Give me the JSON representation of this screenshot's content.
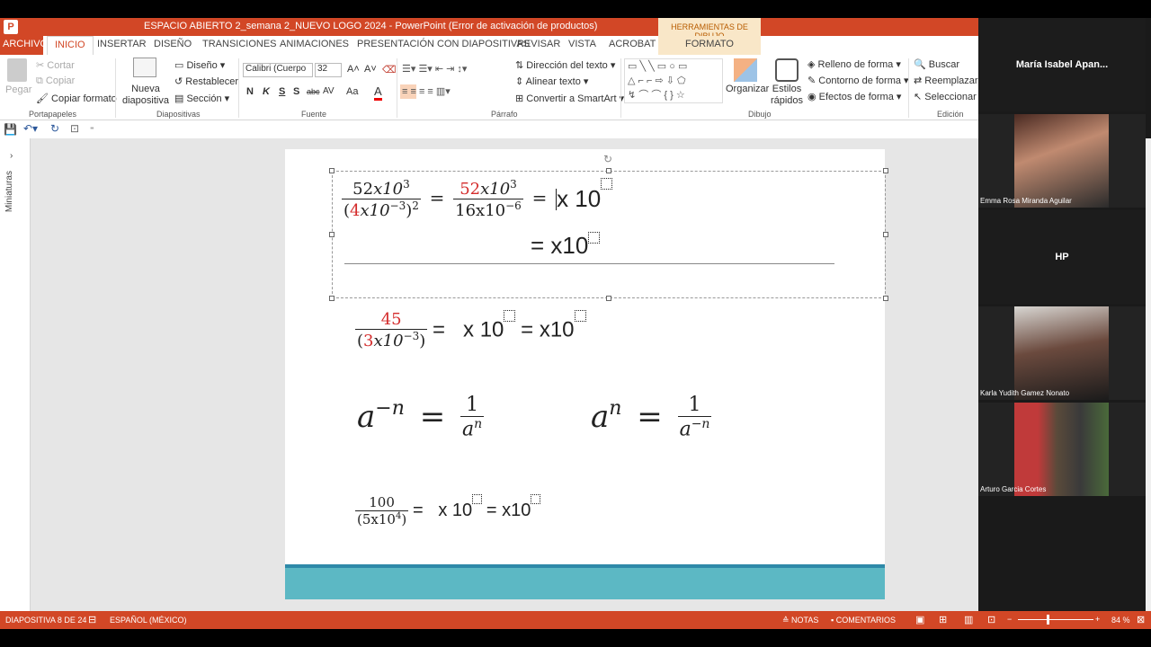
{
  "window": {
    "title": "ESPACIO ABIERTO 2_semana 2_NUEVO LOGO 2024 - PowerPoint (Error de activación de productos)",
    "app_icon": "P"
  },
  "context_tab": {
    "group": "HERRAMIENTAS DE DIBUJO",
    "tab": "FORMATO"
  },
  "tabs": [
    "ARCHIVO",
    "INICIO",
    "INSERTAR",
    "DISEÑO",
    "TRANSICIONES",
    "ANIMACIONES",
    "PRESENTACIÓN CON DIAPOSITIVAS",
    "REVISAR",
    "VISTA",
    "ACROBAT"
  ],
  "ribbon": {
    "portapapeles": {
      "paste": "Pegar",
      "cut": "Cortar",
      "copy": "Copiar",
      "format_painter": "Copiar formato",
      "label": "Portapapeles"
    },
    "diapositivas": {
      "new_slide": "Nueva diapositiva",
      "layout": "Diseño",
      "reset": "Restablecer",
      "section": "Sección",
      "label": "Diapositivas"
    },
    "fuente": {
      "font": "Calibri (Cuerpo",
      "size": "32",
      "label": "Fuente",
      "bold": "N",
      "italic": "K",
      "underline": "S",
      "shadow": "S",
      "strike": "abc",
      "spacing": "AV",
      "case": "Aa",
      "color": "A"
    },
    "parrafo": {
      "direction": "Dirección del texto",
      "align": "Alinear texto",
      "smartart": "Convertir a SmartArt",
      "label": "Párrafo"
    },
    "dibujo": {
      "arrange": "Organizar",
      "quick_styles": "Estilos rápidos",
      "fill": "Relleno de forma",
      "outline": "Contorno de forma",
      "effects": "Efectos de forma",
      "label": "Dibujo"
    },
    "edicion": {
      "find": "Buscar",
      "replace": "Reemplazar",
      "select": "Seleccionar",
      "label": "Edición"
    }
  },
  "sidebar": {
    "label": "Miniaturas"
  },
  "slide": {
    "eq1": {
      "n1": "52",
      "n1b": "x10",
      "n1e": "3",
      "d1a": "(",
      "d1r": "4",
      "d1b": "x10",
      "d1e": "−3",
      "d1c": ")",
      "d1p": "2",
      "eq": "=",
      "n2r": "52",
      "n2b": "x10",
      "n2e": "3",
      "d2": "16x10",
      "d2e": "−6",
      "rhs": "x 10"
    },
    "eq1b": {
      "text": "= x10"
    },
    "eq2": {
      "num": "45",
      "d1": "(",
      "dr": "3",
      "d2": "x10",
      "de": "−3",
      "d3": ")",
      "rhs1": "=   x 10",
      "rhs2": "= x10"
    },
    "eq3": {
      "lhs": "a",
      "exp": "−n",
      "eq": "=",
      "num": "1",
      "den": "a",
      "dexp": "n"
    },
    "eq4": {
      "lhs": "a",
      "exp": "n",
      "eq": "=",
      "num": "1",
      "den": "a",
      "dexp": "−n"
    },
    "eq5": {
      "num": "100",
      "den": "(5x10",
      "dexp": "4",
      "dend": ")",
      "rhs1": "=   x 10",
      "rhs2": "= x10"
    }
  },
  "status": {
    "slide": "DIAPOSITIVA 8 DE 24",
    "lang": "ESPAÑOL (MÉXICO)",
    "notes": "NOTAS",
    "comments": "COMENTARIOS",
    "zoom": "84 %"
  },
  "participants": [
    {
      "name": "María Isabel Apan...",
      "has_video": false
    },
    {
      "name": "Emma Rosa Miranda Aguilar",
      "has_video": true
    },
    {
      "name": "HP",
      "has_video": false
    },
    {
      "name": "Karla Yudith Gamez Nonato",
      "has_video": true
    },
    {
      "name": "Arturo Garcia Cortes",
      "has_video": true
    }
  ],
  "colors": {
    "accent": "#d24726",
    "slide_band": "#5cb8c4",
    "red_math": "#d42c2c"
  }
}
